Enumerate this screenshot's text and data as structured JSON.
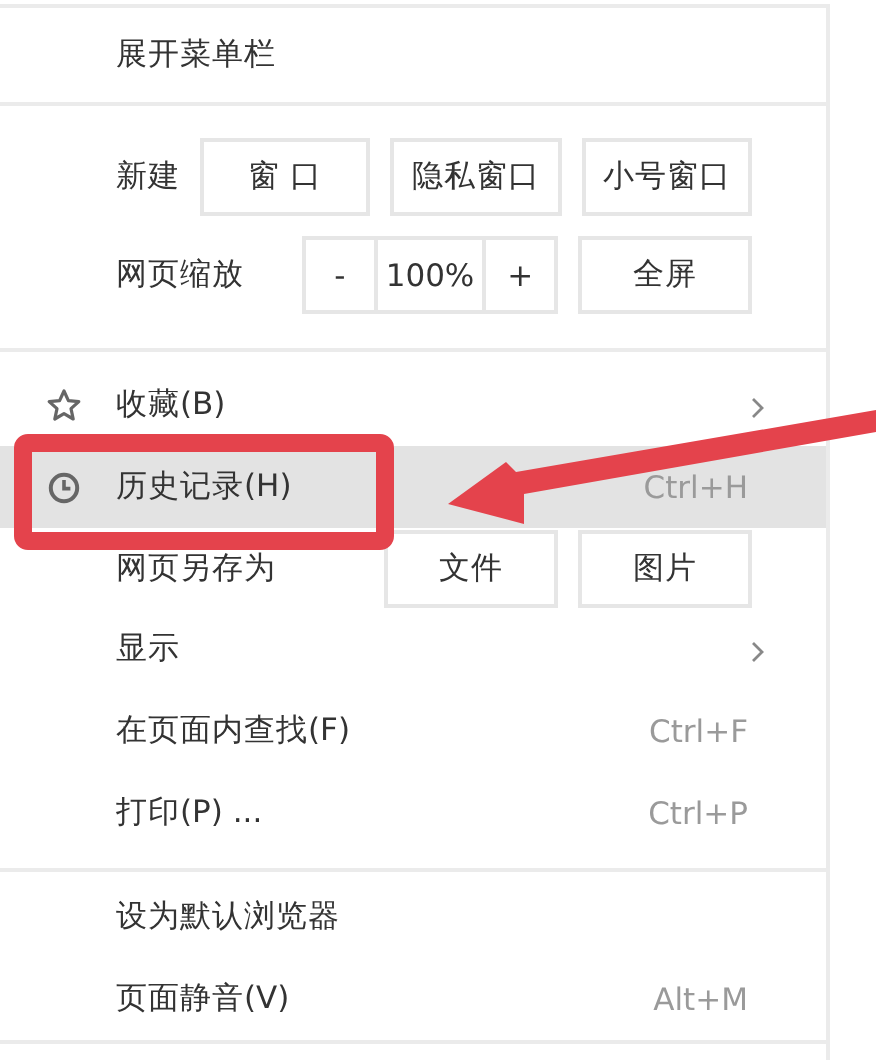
{
  "menu": {
    "sections": [
      {
        "items": [
          {
            "kind": "plain",
            "label": "展开菜单栏",
            "highlighted": false
          }
        ]
      },
      {
        "items": [
          {
            "kind": "buttons",
            "label": "新建",
            "buttons": [
              "窗 口",
              "隐私窗口",
              "小号窗口"
            ]
          },
          {
            "kind": "zoom",
            "label": "网页缩放",
            "minus": "-",
            "value": "100%",
            "plus": "+",
            "buttons": [
              "全屏"
            ]
          }
        ]
      },
      {
        "items": [
          {
            "kind": "entry",
            "label": "收藏(B)",
            "submenu": true,
            "highlighted": false
          },
          {
            "kind": "entry",
            "label": "历史记录(H)",
            "shortcut": "Ctrl+H",
            "submenu": false,
            "highlighted": true
          },
          {
            "kind": "buttons",
            "label": "网页另存为",
            "buttons": [
              "文件",
              "图片"
            ]
          },
          {
            "kind": "entry",
            "label": "显示",
            "submenu": true,
            "highlighted": false
          },
          {
            "kind": "entry",
            "label": "在页面内查找(F)",
            "shortcut": "Ctrl+F",
            "submenu": false,
            "highlighted": false
          },
          {
            "kind": "entry",
            "label": "打印(P) ...",
            "shortcut": "Ctrl+P",
            "submenu": false,
            "highlighted": false
          }
        ]
      },
      {
        "items": [
          {
            "kind": "entry",
            "label": "设为默认浏览器",
            "submenu": false,
            "highlighted": false
          },
          {
            "kind": "entry",
            "label": "页面静音(V)",
            "shortcut": "Alt+M",
            "submenu": false,
            "highlighted": false
          }
        ]
      }
    ]
  },
  "annotation": {
    "kind": "box-arrow"
  }
}
